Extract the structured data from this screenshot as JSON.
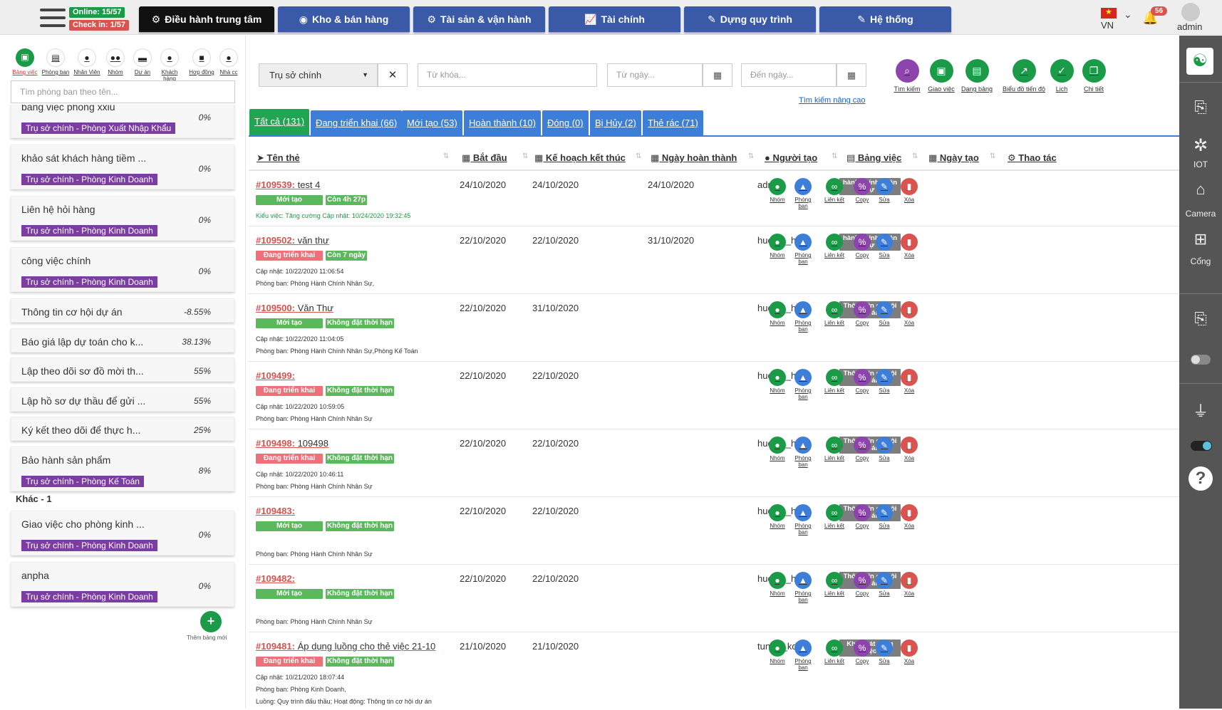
{
  "topbar": {
    "online": "Online: 15/57",
    "checkin": "Check in: 1/57",
    "tabs": [
      {
        "label": "Điều hành trung tâm",
        "icon": "gear-icon"
      },
      {
        "label": "Kho & bán hàng",
        "icon": "globe-icon"
      },
      {
        "label": "Tài sản & vận hành",
        "icon": "cogs-icon"
      },
      {
        "label": "Tài chính",
        "icon": "chart-icon"
      },
      {
        "label": "Dựng quy trình",
        "icon": "edit-icon"
      },
      {
        "label": "Hệ thống",
        "icon": "edit-icon"
      }
    ],
    "lang": "VN",
    "notifications": "56",
    "user": "admin"
  },
  "left": {
    "icons": [
      "Bảng việc",
      "Phòng ban",
      "Nhân Viên",
      "Nhóm",
      "Dự án",
      "Khách hàng",
      "Hợp đồng",
      "Nhà cc"
    ],
    "search_placeholder": "Tìm phòng ban theo tên...",
    "cards": [
      {
        "title": "bảng việc phòng xxiu",
        "pct": "0%",
        "tag": "Trụ sở chính - Phòng Xuất Nhập Khẩu"
      },
      {
        "title": "khảo sát khách hàng tiềm ...",
        "pct": "0%",
        "tag": "Trụ sở chính - Phòng Kinh Doanh"
      },
      {
        "title": "Liên hệ hỏi hàng",
        "pct": "0%",
        "tag": "Trụ sở chính - Phòng Kinh Doanh"
      },
      {
        "title": "công việc chính",
        "pct": "0%",
        "tag": "Trụ sở chính - Phòng Kinh Doanh"
      },
      {
        "title": "Thông tin cơ hội dự án",
        "pct": "-8.55%",
        "tag": ""
      },
      {
        "title": "Báo giá lập dự toán cho k...",
        "pct": "38.13%",
        "tag": ""
      },
      {
        "title": "Lập theo dõi sơ đồ mời th...",
        "pct": "55%",
        "tag": ""
      },
      {
        "title": "Lập hồ sơ dự thầu để gửi ...",
        "pct": "55%",
        "tag": ""
      },
      {
        "title": "Ký kết theo dõi để thực h...",
        "pct": "25%",
        "tag": ""
      },
      {
        "title": "Bảo hành sản phẩm",
        "pct": "8%",
        "tag": "Trụ sở chính - Phòng Kế Toán"
      },
      {
        "title": "Giao việc cho phòng kinh ...",
        "pct": "0%",
        "tag": "Trụ sở chính - Phòng Kinh Doanh"
      },
      {
        "title": "anpha",
        "pct": "0%",
        "tag": "Trụ sở chính - Phòng Kinh Doanh"
      }
    ],
    "group_label": "Khác - 1",
    "add_label": "Thêm bảng mới"
  },
  "filters": {
    "branch": "Trụ sở chính",
    "keyword_placeholder": "Từ khóa...",
    "from_placeholder": "Từ ngày...",
    "to_placeholder": "Đến ngày...",
    "actions": [
      "Tìm kiếm",
      "Giao việc",
      "Dạng bảng",
      "Biểu đồ tiến độ",
      "Lịch",
      "Chi tiết"
    ],
    "advanced": "Tìm kiếm nâng cao",
    "tabs": [
      "Tất cả (131)",
      "Đang triển khai (66)",
      "Mới tạo (53)",
      "Hoàn thành (10)",
      "Đóng (0)",
      "Bị Hủy (2)",
      "Thẻ rác (71)"
    ]
  },
  "table": {
    "headers": [
      "Tên thẻ",
      "Bắt đầu",
      "Kế hoạch kết thúc",
      "Ngày hoàn thành",
      "Người tạo",
      "Bảng việc",
      "Ngày tạo",
      "Thao tác"
    ],
    "action_labels": [
      "Nhóm",
      "Phòng ban",
      "Liên kết",
      "Copy",
      "Sửa",
      "Xóa"
    ],
    "rows": [
      {
        "id": "#109539:",
        "name": "test 4",
        "start": "24/10/2020",
        "plan": "24/10/2020",
        "done": "24/10/2020",
        "creator": "admin",
        "board": "hành chính nhân sự",
        "status": "Mới tạo",
        "time": "Còn 4h 27p",
        "line1": "Kiểu việc: Tăng cường   Cập nhật: 10/24/2020 19:32:45",
        "line2": ""
      },
      {
        "id": "#109502:",
        "name": "văn thư",
        "start": "22/10/2020",
        "plan": "22/10/2020",
        "done": "31/10/2020",
        "creator": "huehtb_hc",
        "board": "hành chính nhân sự",
        "status": "Đang triển khai",
        "time": "Còn 7 ngày",
        "line1": "Cập nhật: 10/22/2020 11:06:54",
        "line2": "Phòng ban: Phòng Hành Chính Nhân Sự,"
      },
      {
        "id": "#109500:",
        "name": "Văn Thư",
        "start": "22/10/2020",
        "plan": "31/10/2020",
        "done": "",
        "creator": "huehtb_hc",
        "board": "Thông tin cơ hội dự án",
        "status": "Mới tạo",
        "time": "Không đặt thời hạn",
        "line1": "Cập nhật: 10/22/2020 11:04:05",
        "line2": "Phòng ban: Phòng Hành Chính Nhân Sự,Phòng Kế Toán"
      },
      {
        "id": "#109499:",
        "name": "",
        "start": "22/10/2020",
        "plan": "22/10/2020",
        "done": "",
        "creator": "huehtb_hc",
        "board": "Thông tin cơ hội dự án",
        "status": "Đang triển khai",
        "time": "Không đặt thời hạn",
        "line1": "Cập nhật: 10/22/2020 10:59:05",
        "line2": "Phòng ban: Phòng Hành Chính Nhân Sự"
      },
      {
        "id": "#109498:",
        "name": "109498",
        "start": "22/10/2020",
        "plan": "22/10/2020",
        "done": "",
        "creator": "huehtb_hc",
        "board": "Thông tin cơ hội dự án",
        "status": "Đang triển khai",
        "time": "Không đặt thời hạn",
        "line1": "Cập nhật: 10/22/2020 10:46:11",
        "line2": "Phòng ban: Phòng Hành Chính Nhân Sự"
      },
      {
        "id": "#109483:",
        "name": "",
        "start": "22/10/2020",
        "plan": "22/10/2020",
        "done": "",
        "creator": "huehtb_hc",
        "board": "Thông tin cơ hội dự án",
        "status": "Mới tạo",
        "time": "Không đặt thời hạn",
        "line1": "",
        "line2": "Phòng ban: Phòng Hành Chính Nhân Sự"
      },
      {
        "id": "#109482:",
        "name": "",
        "start": "22/10/2020",
        "plan": "22/10/2020",
        "done": "",
        "creator": "huehtb_hc",
        "board": "Thông tin cơ hội dự án",
        "status": "Mới tạo",
        "time": "Không đặt thời hạn",
        "line1": "",
        "line2": "Phòng ban: Phòng Hành Chính Nhân Sự"
      },
      {
        "id": "#109481:",
        "name": "Áp dụng luồng cho thẻ việc 21-10",
        "start": "21/10/2020",
        "plan": "21/10/2020",
        "done": "",
        "creator": "tunglc_kd",
        "board": "Khảo sát công việc",
        "status": "Đang triển khai",
        "time": "Không đặt thời hạn",
        "line1": "Cập nhật: 10/21/2020 18:07:44",
        "line2": "Phòng ban: Phòng Kinh Doanh,",
        "line3": "Luồng: Quy trình đấu thầu; Hoạt động: Thông tin cơ hội dự án"
      }
    ]
  },
  "right": {
    "items": [
      "IOT",
      "Camera",
      "Cổng"
    ]
  },
  "colors": {
    "nav": "#3a5aa8",
    "green": "#1b9a47",
    "red": "#d9534f",
    "purple": "#7a3ea1",
    "blue": "#3d7fd8"
  }
}
